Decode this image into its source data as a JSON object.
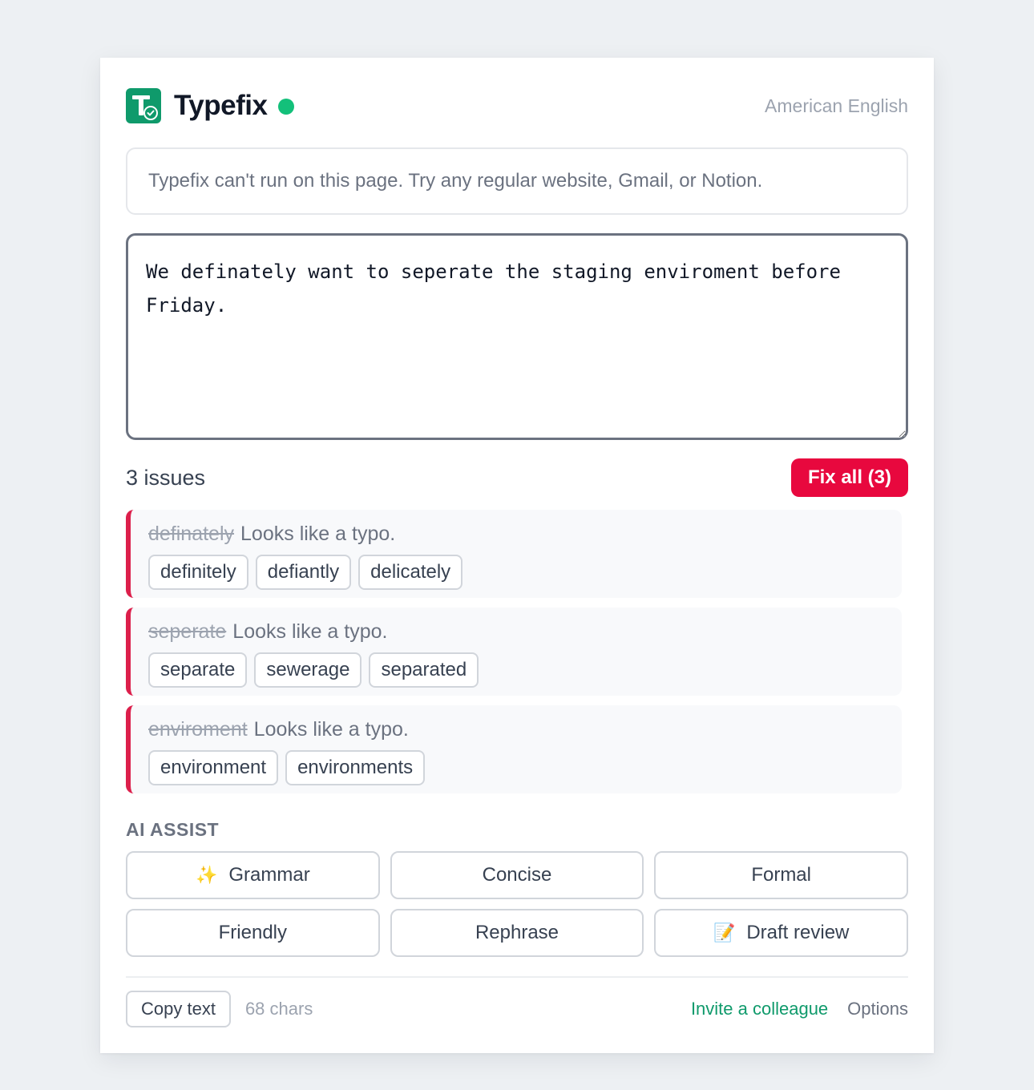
{
  "app": {
    "name": "Typefix",
    "status_color": "#13c07a",
    "brand_color": "#0f9a6b",
    "logo_icon": "typefix-logo-icon",
    "language": "American English"
  },
  "notice": {
    "text": "Typefix can't run on this page. Try any regular website, Gmail, or Notion."
  },
  "editor": {
    "value": "We definately want to seperate the staging enviroment before Friday."
  },
  "issues": {
    "count_label": "3 issues",
    "fix_all_label": "Fix all (3)",
    "accent_color": "#e8083e",
    "items": [
      {
        "word": "definately",
        "message": "Looks like a typo.",
        "suggestions": [
          "definitely",
          "defiantly",
          "delicately"
        ]
      },
      {
        "word": "seperate",
        "message": "Looks like a typo.",
        "suggestions": [
          "separate",
          "sewerage",
          "separated"
        ]
      },
      {
        "word": "enviroment",
        "message": "Looks like a typo.",
        "suggestions": [
          "environment",
          "environments"
        ]
      }
    ]
  },
  "ai_assist": {
    "heading": "AI ASSIST",
    "buttons": [
      {
        "label": "Grammar",
        "emoji": "✨"
      },
      {
        "label": "Concise",
        "emoji": ""
      },
      {
        "label": "Formal",
        "emoji": ""
      },
      {
        "label": "Friendly",
        "emoji": ""
      },
      {
        "label": "Rephrase",
        "emoji": ""
      },
      {
        "label": "Draft review",
        "emoji": "📝"
      }
    ]
  },
  "footer": {
    "copy_label": "Copy text",
    "char_count": "68 chars",
    "invite_label": "Invite a colleague",
    "options_label": "Options"
  }
}
